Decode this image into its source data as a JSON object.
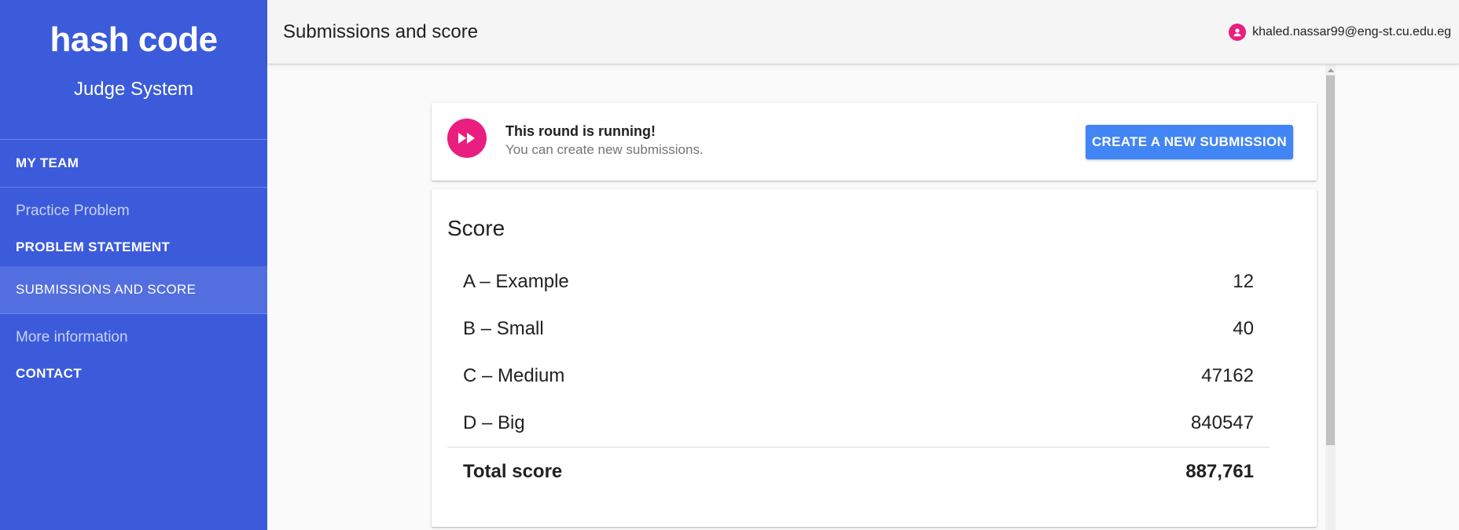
{
  "sidebar": {
    "logo": "hash code",
    "subtitle": "Judge System",
    "my_team": "MY TEAM",
    "practice_heading": "Practice Problem",
    "problem_statement": "PROBLEM STATEMENT",
    "submissions": "SUBMISSIONS AND SCORE",
    "more_heading": "More information",
    "contact": "CONTACT"
  },
  "header": {
    "title": "Submissions and score",
    "user_email": "khaled.nassar99@eng-st.cu.edu.eg",
    "user_icon": "account-circle-icon"
  },
  "status": {
    "icon": "fast-forward-icon",
    "title": "This round is running!",
    "description": "You can create new submissions.",
    "button_label": "CREATE A NEW SUBMISSION"
  },
  "score": {
    "title": "Score",
    "rows": [
      {
        "name": "A – Example",
        "value": "12"
      },
      {
        "name": "B – Small",
        "value": "40"
      },
      {
        "name": "C – Medium",
        "value": "47162"
      },
      {
        "name": "D – Big",
        "value": "840547"
      }
    ],
    "total_label": "Total score",
    "total_value": "887,761"
  },
  "colors": {
    "sidebar": "#3b5bdb",
    "accent_pink": "#e91e7f",
    "button_blue": "#4285f4"
  }
}
